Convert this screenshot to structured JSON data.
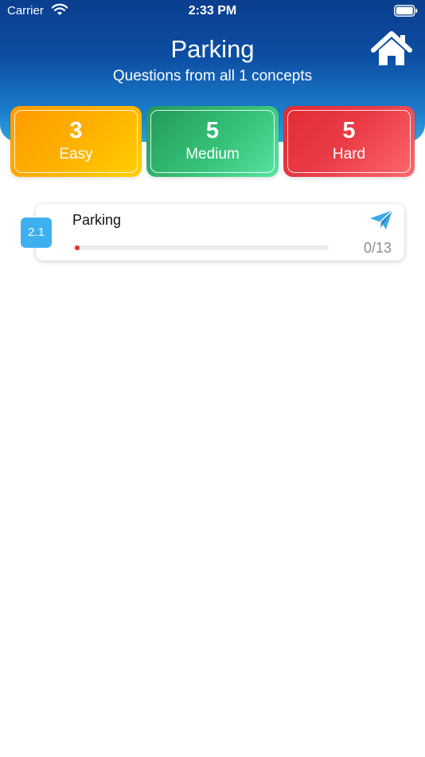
{
  "status_bar": {
    "carrier": "Carrier",
    "time": "2:33 PM"
  },
  "header": {
    "title": "Parking",
    "subtitle": "Questions from all 1 concepts",
    "home_icon": "home-icon"
  },
  "difficulty": [
    {
      "count": "3",
      "label": "Easy",
      "color": "#ffb000"
    },
    {
      "count": "5",
      "label": "Medium",
      "color": "#36c178"
    },
    {
      "count": "5",
      "label": "Hard",
      "color": "#ea3d47"
    }
  ],
  "concepts": [
    {
      "number": "2.1",
      "name": "Parking",
      "progress_text": "0/13",
      "progress": 0,
      "icon": "send-icon"
    }
  ]
}
